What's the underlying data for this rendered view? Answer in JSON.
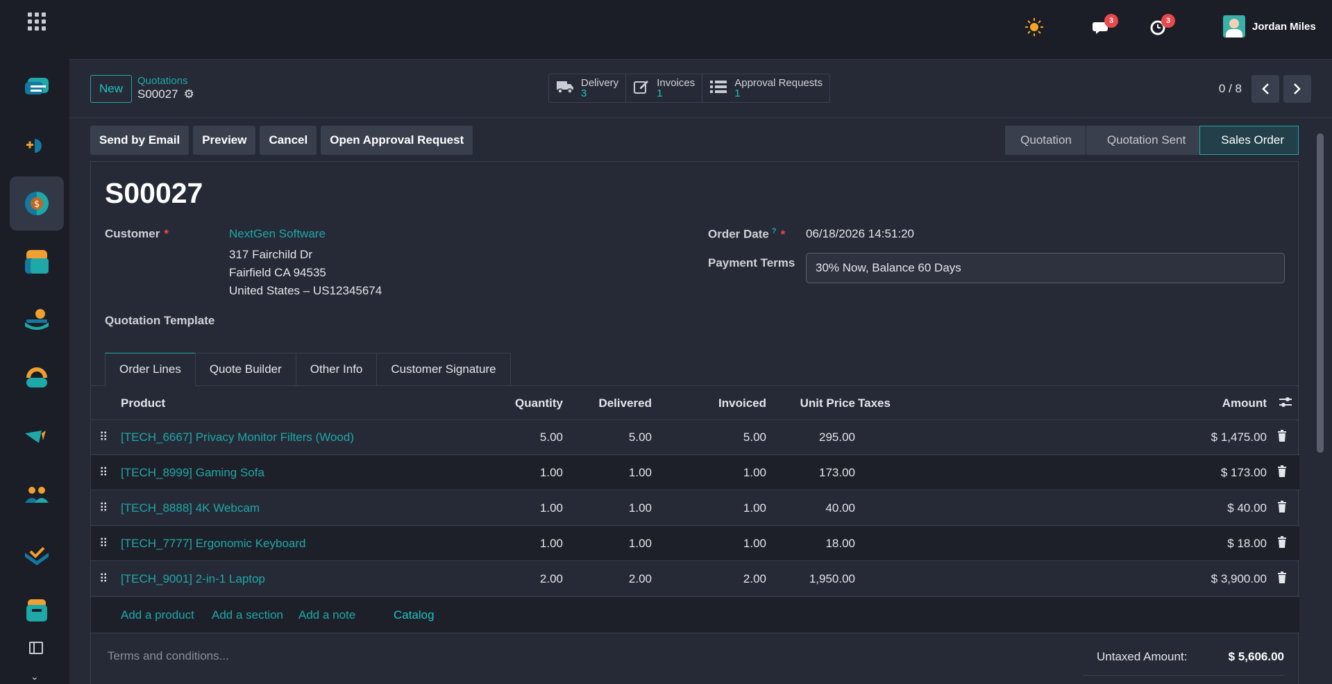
{
  "topbar": {
    "user_name": "Jordan Miles",
    "messages_count": "3",
    "activities_count": "3"
  },
  "control": {
    "new_label": "New",
    "breadcrumb_parent": "Quotations",
    "breadcrumb_current": "S00027",
    "smart_buttons": [
      {
        "label": "Delivery",
        "count": "3",
        "icon": "truck-icon"
      },
      {
        "label": "Invoices",
        "count": "1",
        "icon": "edit-icon"
      },
      {
        "label": "Approval Requests",
        "count": "1",
        "icon": "list-icon"
      }
    ],
    "pager": "0 / 8"
  },
  "actions": [
    "Send by Email",
    "Preview",
    "Cancel",
    "Open Approval Request"
  ],
  "statusbar": [
    "Quotation",
    "Quotation Sent",
    "Sales Order"
  ],
  "form": {
    "title": "S00027",
    "customer_label": "Customer",
    "customer_name": "NextGen Software",
    "address_line1": "317 Fairchild Dr",
    "address_line2": "Fairfield CA 94535",
    "address_line3": "United States – US12345674",
    "quotation_template_label": "Quotation Template",
    "order_date_label": "Order Date",
    "order_date_tooltip": "?",
    "order_date_value": "06/18/2026 14:51:20",
    "payment_terms_label": "Payment Terms",
    "payment_terms_value": "30% Now, Balance 60 Days",
    "required_mark": "*"
  },
  "tabs": [
    "Order Lines",
    "Quote Builder",
    "Other Info",
    "Customer Signature"
  ],
  "table": {
    "headers": {
      "product": "Product",
      "quantity": "Quantity",
      "delivered": "Delivered",
      "invoiced": "Invoiced",
      "unit_price": "Unit Price",
      "taxes": "Taxes",
      "amount": "Amount"
    },
    "rows": [
      {
        "product": "[TECH_6667] Privacy Monitor Filters (Wood)",
        "quantity": "5.00",
        "delivered": "5.00",
        "invoiced": "5.00",
        "unit_price": "295.00",
        "amount": "$ 1,475.00"
      },
      {
        "product": "[TECH_8999] Gaming Sofa",
        "quantity": "1.00",
        "delivered": "1.00",
        "invoiced": "1.00",
        "unit_price": "173.00",
        "amount": "$ 173.00"
      },
      {
        "product": "[TECH_8888] 4K Webcam",
        "quantity": "1.00",
        "delivered": "1.00",
        "invoiced": "1.00",
        "unit_price": "40.00",
        "amount": "$ 40.00"
      },
      {
        "product": "[TECH_7777] Ergonomic Keyboard",
        "quantity": "1.00",
        "delivered": "1.00",
        "invoiced": "1.00",
        "unit_price": "18.00",
        "amount": "$ 18.00"
      },
      {
        "product": "[TECH_9001] 2-in-1 Laptop",
        "quantity": "2.00",
        "delivered": "2.00",
        "invoiced": "2.00",
        "unit_price": "1,950.00",
        "amount": "$ 3,900.00"
      }
    ],
    "add_product": "Add a product",
    "add_section": "Add a section",
    "add_note": "Add a note",
    "catalog": "Catalog"
  },
  "footer": {
    "terms_placeholder": "Terms and conditions...",
    "untaxed_label": "Untaxed Amount:",
    "untaxed_value": "$ 5,606.00"
  }
}
